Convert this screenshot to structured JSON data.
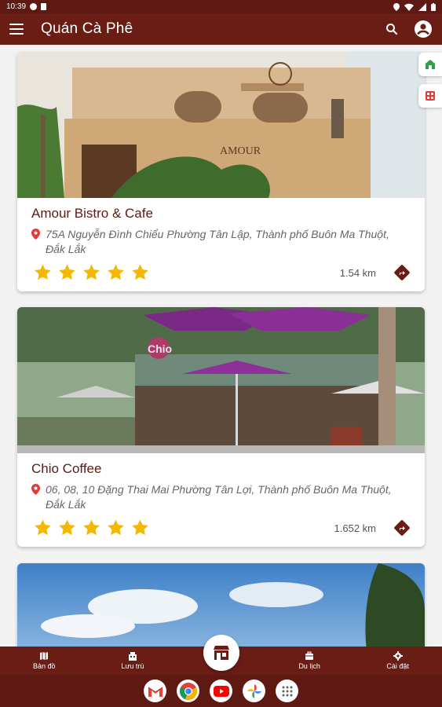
{
  "status_bar": {
    "time": "10:39"
  },
  "app_bar": {
    "title": "Quán Cà Phê"
  },
  "cafes": [
    {
      "name": "Amour Bistro & Cafe",
      "address": "75A Nguyễn Đình Chiểu Phường Tân Lập, Thành phố Buôn Ma Thuột, Đắk Lắk",
      "rating": 5,
      "distance": "1.54 km",
      "photo_sign": "AMOUR"
    },
    {
      "name": "Chio Coffee",
      "address": "06, 08, 10 Đặng Thai Mai Phường Tân Lợi, Thành phố Buôn Ma Thuột, Đắk Lắk",
      "rating": 5,
      "distance": "1.652 km",
      "photo_sign": "Chio"
    }
  ],
  "bottom_nav": {
    "map": "Bản đồ",
    "stay": "Lưu trú",
    "travel": "Du lịch",
    "settings": "Cài đặt"
  },
  "colors": {
    "primary": "#6a1d15",
    "star": "#f5b800",
    "card_bg": "#ffffff"
  },
  "taskbar_apps": [
    "gmail-icon",
    "chrome-icon",
    "youtube-icon",
    "photos-icon",
    "app-drawer-icon"
  ]
}
